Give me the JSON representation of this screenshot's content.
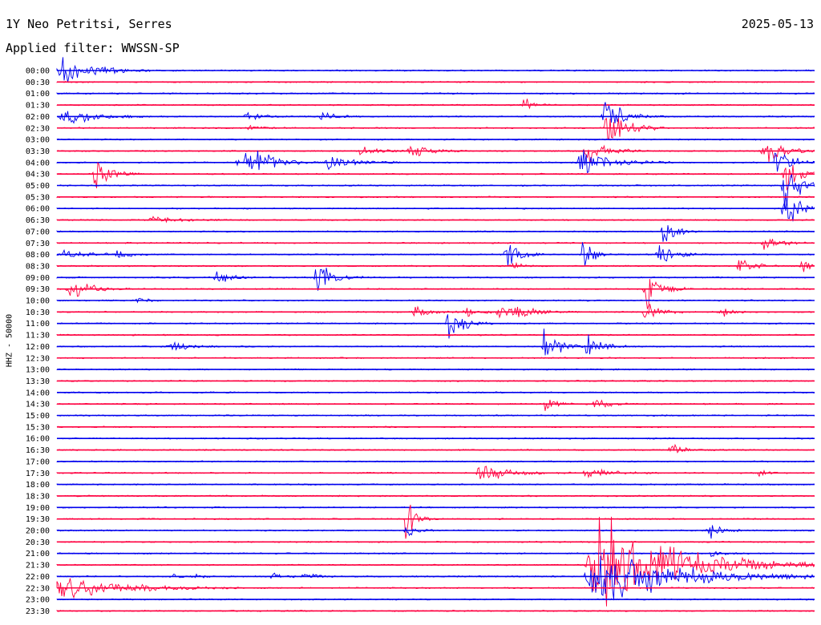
{
  "header": {
    "station": "1Y Neo Petritsi, Serres",
    "date": "2025-05-13",
    "filter": "Applied filter: WWSSN-SP"
  },
  "colors": {
    "even": "#0000ee",
    "odd": "#ff0040"
  },
  "chart_data": {
    "type": "line",
    "title": "1Y Neo Petritsi, Serres",
    "ylabel": "HHZ - 50000",
    "row_labels": [
      "00:00",
      "00:30",
      "01:00",
      "01:30",
      "02:00",
      "02:30",
      "03:00",
      "03:30",
      "04:00",
      "04:30",
      "05:00",
      "05:30",
      "06:00",
      "06:30",
      "07:00",
      "07:30",
      "08:00",
      "08:30",
      "09:00",
      "09:30",
      "10:00",
      "10:30",
      "11:00",
      "11:30",
      "12:00",
      "12:30",
      "13:00",
      "13:30",
      "14:00",
      "14:30",
      "15:00",
      "15:30",
      "16:00",
      "16:30",
      "17:00",
      "17:30",
      "18:00",
      "18:30",
      "19:00",
      "19:30",
      "20:00",
      "20:30",
      "21:00",
      "21:30",
      "22:00",
      "22:30",
      "23:00",
      "23:30"
    ],
    "row_minutes": 30,
    "events": [
      {
        "row": 0,
        "minute": 0.2,
        "amp": 1.6,
        "dur": 3
      },
      {
        "row": 3,
        "minute": 18.5,
        "amp": 0.9,
        "dur": 1
      },
      {
        "row": 4,
        "minute": 0.3,
        "amp": 1.0,
        "dur": 3
      },
      {
        "row": 4,
        "minute": 7.5,
        "amp": 0.5,
        "dur": 1.5
      },
      {
        "row": 4,
        "minute": 10.5,
        "amp": 0.5,
        "dur": 1.5
      },
      {
        "row": 4,
        "minute": 21.7,
        "amp": 2.0,
        "dur": 2
      },
      {
        "row": 5,
        "minute": 7.5,
        "amp": 0.4,
        "dur": 1
      },
      {
        "row": 5,
        "minute": 21.8,
        "amp": 2.2,
        "dur": 2
      },
      {
        "row": 7,
        "minute": 12.0,
        "amp": 0.7,
        "dur": 1.5
      },
      {
        "row": 7,
        "minute": 14.0,
        "amp": 0.8,
        "dur": 2
      },
      {
        "row": 7,
        "minute": 21.0,
        "amp": 1.5,
        "dur": 2
      },
      {
        "row": 7,
        "minute": 28.0,
        "amp": 1.5,
        "dur": 2
      },
      {
        "row": 8,
        "minute": 7.2,
        "amp": 1.5,
        "dur": 2
      },
      {
        "row": 8,
        "minute": 7.8,
        "amp": 0.9,
        "dur": 2.5
      },
      {
        "row": 8,
        "minute": 10.8,
        "amp": 0.9,
        "dur": 2.5
      },
      {
        "row": 8,
        "minute": 20.8,
        "amp": 1.5,
        "dur": 3
      },
      {
        "row": 8,
        "minute": 28.5,
        "amp": 2.0,
        "dur": 1.5
      },
      {
        "row": 9,
        "minute": 1.5,
        "amp": 2.0,
        "dur": 1.5
      },
      {
        "row": 9,
        "minute": 28.8,
        "amp": 2.0,
        "dur": 1.5
      },
      {
        "row": 10,
        "minute": 28.8,
        "amp": 3.0,
        "dur": 1.5
      },
      {
        "row": 12,
        "minute": 28.8,
        "amp": 3.0,
        "dur": 1.5
      },
      {
        "row": 13,
        "minute": 3.8,
        "amp": 0.5,
        "dur": 2.5
      },
      {
        "row": 14,
        "minute": 24.0,
        "amp": 1.5,
        "dur": 1.2
      },
      {
        "row": 15,
        "minute": 28.0,
        "amp": 0.6,
        "dur": 2
      },
      {
        "row": 16,
        "minute": 0.3,
        "amp": 0.4,
        "dur": 3
      },
      {
        "row": 16,
        "minute": 2.4,
        "amp": 0.7,
        "dur": 1
      },
      {
        "row": 16,
        "minute": 17.8,
        "amp": 1.6,
        "dur": 1.5
      },
      {
        "row": 16,
        "minute": 20.8,
        "amp": 1.6,
        "dur": 1.2
      },
      {
        "row": 16,
        "minute": 23.8,
        "amp": 1.6,
        "dur": 1.5
      },
      {
        "row": 17,
        "minute": 18.0,
        "amp": 0.6,
        "dur": 1.2
      },
      {
        "row": 17,
        "minute": 27.0,
        "amp": 1.0,
        "dur": 1.5
      },
      {
        "row": 17,
        "minute": 29.5,
        "amp": 0.9,
        "dur": 1
      },
      {
        "row": 18,
        "minute": 6.3,
        "amp": 1.1,
        "dur": 1.2
      },
      {
        "row": 18,
        "minute": 10.3,
        "amp": 2.3,
        "dur": 1.5
      },
      {
        "row": 19,
        "minute": 0.5,
        "amp": 1.3,
        "dur": 2
      },
      {
        "row": 19,
        "minute": 23.3,
        "amp": 2.3,
        "dur": 1.5
      },
      {
        "row": 20,
        "minute": 3.2,
        "amp": 0.4,
        "dur": 1
      },
      {
        "row": 21,
        "minute": 14.2,
        "amp": 0.6,
        "dur": 1.5
      },
      {
        "row": 21,
        "minute": 16.2,
        "amp": 0.6,
        "dur": 1.5
      },
      {
        "row": 21,
        "minute": 17.5,
        "amp": 0.6,
        "dur": 1.5
      },
      {
        "row": 21,
        "minute": 18.0,
        "amp": 0.7,
        "dur": 2.5
      },
      {
        "row": 21,
        "minute": 23.3,
        "amp": 1.0,
        "dur": 1.5
      },
      {
        "row": 21,
        "minute": 26.3,
        "amp": 0.7,
        "dur": 1
      },
      {
        "row": 22,
        "minute": 15.5,
        "amp": 2.0,
        "dur": 1.5
      },
      {
        "row": 24,
        "minute": 4.5,
        "amp": 0.5,
        "dur": 2
      },
      {
        "row": 24,
        "minute": 19.3,
        "amp": 2.3,
        "dur": 1.5
      },
      {
        "row": 24,
        "minute": 21.0,
        "amp": 1.6,
        "dur": 1.5
      },
      {
        "row": 29,
        "minute": 19.3,
        "amp": 0.9,
        "dur": 1
      },
      {
        "row": 29,
        "minute": 21.3,
        "amp": 0.9,
        "dur": 1.2
      },
      {
        "row": 33,
        "minute": 24.3,
        "amp": 0.7,
        "dur": 1.2
      },
      {
        "row": 35,
        "minute": 16.8,
        "amp": 0.9,
        "dur": 3
      },
      {
        "row": 35,
        "minute": 21.0,
        "amp": 0.6,
        "dur": 2.5
      },
      {
        "row": 35,
        "minute": 27.8,
        "amp": 0.5,
        "dur": 0.8
      },
      {
        "row": 39,
        "minute": 13.8,
        "amp": 2.5,
        "dur": 1
      },
      {
        "row": 40,
        "minute": 13.8,
        "amp": 1.0,
        "dur": 1
      },
      {
        "row": 40,
        "minute": 25.8,
        "amp": 1.2,
        "dur": 1.2
      },
      {
        "row": 42,
        "minute": 25.8,
        "amp": 0.7,
        "dur": 1
      },
      {
        "row": 43,
        "minute": 21.5,
        "amp": 5.0,
        "dur": 8
      },
      {
        "row": 44,
        "minute": 4.5,
        "amp": 0.3,
        "dur": 1
      },
      {
        "row": 44,
        "minute": 5.5,
        "amp": 0.3,
        "dur": 1
      },
      {
        "row": 44,
        "minute": 8.5,
        "amp": 0.4,
        "dur": 1.5
      },
      {
        "row": 44,
        "minute": 9.8,
        "amp": 0.3,
        "dur": 1.5
      },
      {
        "row": 44,
        "minute": 21.5,
        "amp": 3.0,
        "dur": 8.5
      },
      {
        "row": 45,
        "minute": 0.0,
        "amp": 1.5,
        "dur": 6
      }
    ]
  }
}
